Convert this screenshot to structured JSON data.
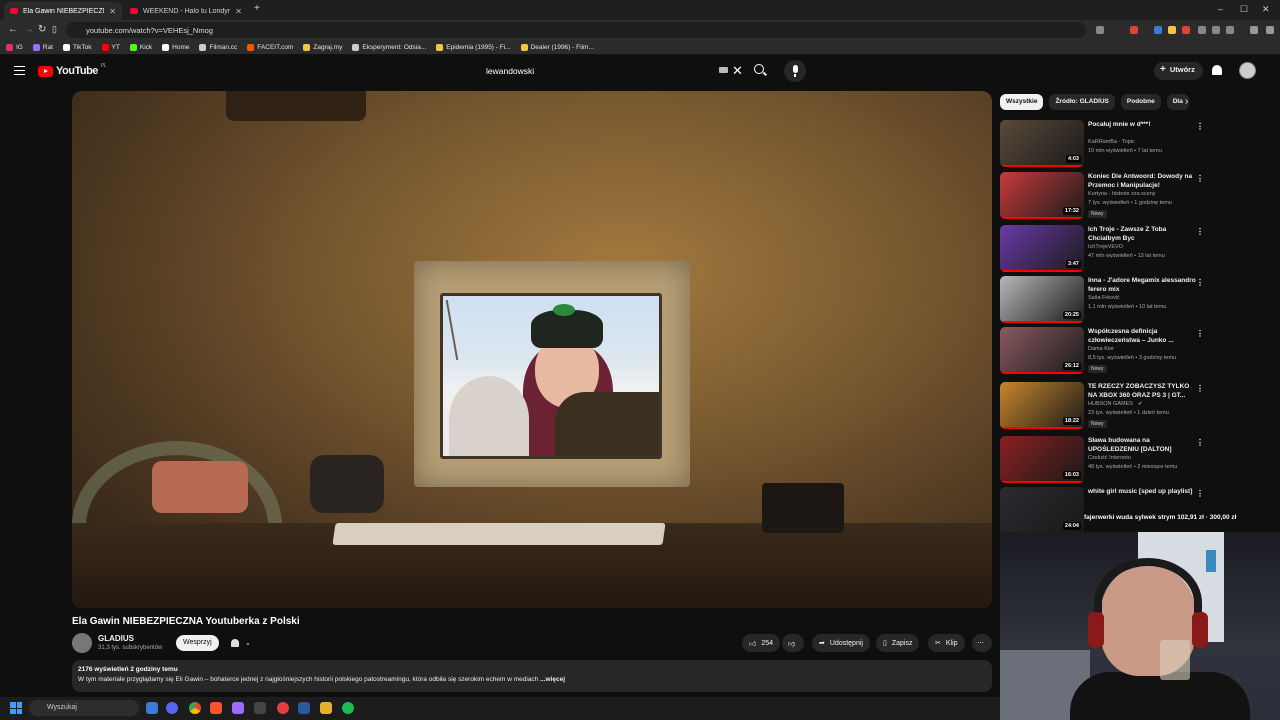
{
  "browser": {
    "tabs": [
      {
        "title": "Ela Gawin NIEBEZPIECZNA Yo",
        "active": true
      },
      {
        "title": "WEEKEND - Halo tu Londyn (Oficjaln",
        "active": false
      }
    ],
    "url": "youtube.com/watch?v=VEHEsj_Nmog",
    "bookmarks": [
      {
        "label": "IG",
        "color": "#e1306c"
      },
      {
        "label": "Rat",
        "color": "#9c6bff"
      },
      {
        "label": "TikTok",
        "color": "#ffffff"
      },
      {
        "label": "YT",
        "color": "#ff0000"
      },
      {
        "label": "Kick",
        "color": "#53fc18"
      },
      {
        "label": "Home",
        "color": "#ffffff"
      },
      {
        "label": "Filman.cc",
        "color": "#cccccc"
      },
      {
        "label": "FACEIT.com",
        "color": "#ff5500"
      },
      {
        "label": "Zagraj.my",
        "color": "#f5c542"
      },
      {
        "label": "Eksperyment: Odsia...",
        "color": "#cccccc"
      },
      {
        "label": "Epidemia (1995) - Fi...",
        "color": "#f5c542"
      },
      {
        "label": "Dealer (1996) - Film...",
        "color": "#f5c542"
      }
    ]
  },
  "youtube": {
    "logo": "YouTube",
    "locale": "PL",
    "search_value": "lewandowski",
    "create_label": "Utwórz"
  },
  "video": {
    "title": "Ela Gawin NIEBEZPIECZNA Youtuberka z Polski",
    "channel": "GLADIUS",
    "subscribers": "31,3 tys. subskrybentów",
    "support_label": "Wesprzyj",
    "likes": "254",
    "share_label": "Udostępnij",
    "save_label": "Zapisz",
    "clip_label": "Klip",
    "views_meta": "2176 wyświetleń  2 godziny temu",
    "description": "W tym materiale przyglądamy się Eli Gawin – bohaterce jednej z najgłośniejszych historii polskiego patostreamingu, która odbiła się szerokim echem w mediach",
    "more_label": "...więcej"
  },
  "chips": [
    "Wszystkie",
    "Źródło: GLADIUS",
    "Podobne",
    "Dla"
  ],
  "recommendations": [
    {
      "title": "Pocałuj mnie w d***!",
      "channel": "KaRRamBa - Topic",
      "meta": "10 mln wyświetleń • 7 lat temu",
      "duration": "4:03",
      "badge": "",
      "verified": false,
      "thumb": "#5a4a3a"
    },
    {
      "title": "Koniec Die Antwoord: Dowody na Przemoc i Manipulacje!",
      "channel": "Kurtyna - historie zza sceny",
      "meta": "7 tys. wyświetleń • 1 godzinę temu",
      "duration": "17:32",
      "badge": "Nowy",
      "verified": false,
      "thumb": "#c83a3a"
    },
    {
      "title": "Ich Troje - Zawsze Z Toba Chcialbym Byc",
      "channel": "IchTrojeVEVO",
      "meta": "47 mln wyświetleń • 13 lat temu",
      "duration": "3:47",
      "badge": "",
      "verified": false,
      "thumb": "#6a3aa8"
    },
    {
      "title": "Inna - J'adore Megamix alessandro ferero mix",
      "channel": "Saša Frković",
      "meta": "1,1 mln wyświetleń • 10 lat temu",
      "duration": "20:25",
      "badge": "",
      "verified": false,
      "thumb": "#b8b8bc"
    },
    {
      "title": "Współczesna definicja człowieczeństwa – Junko ...",
      "channel": "Dama Kier",
      "meta": "8,5 tys. wyświetleń • 3 godziny temu",
      "duration": "26:12",
      "badge": "Nowy",
      "verified": false,
      "thumb": "#8a5a60"
    },
    {
      "title": "TE RZECZY ZOBACZYSZ TYLKO NA XBOX 360 ORAZ PS 3 | GT...",
      "channel": "HUBSON GAMES",
      "meta": "23 tys. wyświetleń • 1 dzień temu",
      "duration": "18:22",
      "badge": "Nowy",
      "verified": true,
      "thumb": "#c9862a"
    },
    {
      "title": "Sława budowana na UPOŚLEDZENIU [DALTON]",
      "channel": "Czeluść Internetu",
      "meta": "48 tys. wyświetleń • 2 miesiące temu",
      "duration": "16:03",
      "badge": "",
      "verified": false,
      "thumb": "#8a1f1f"
    },
    {
      "title": "white girl music [sped up playlist]",
      "channel": "",
      "meta": "",
      "duration": "24:04",
      "badge": "",
      "verified": false,
      "thumb": "#2a2a30"
    }
  ],
  "stream_overlay": "fajerwerki wuda sylwek strym  102,91 zł  ·  300,00 zł",
  "taskbar": {
    "search_placeholder": "Wyszukaj"
  }
}
